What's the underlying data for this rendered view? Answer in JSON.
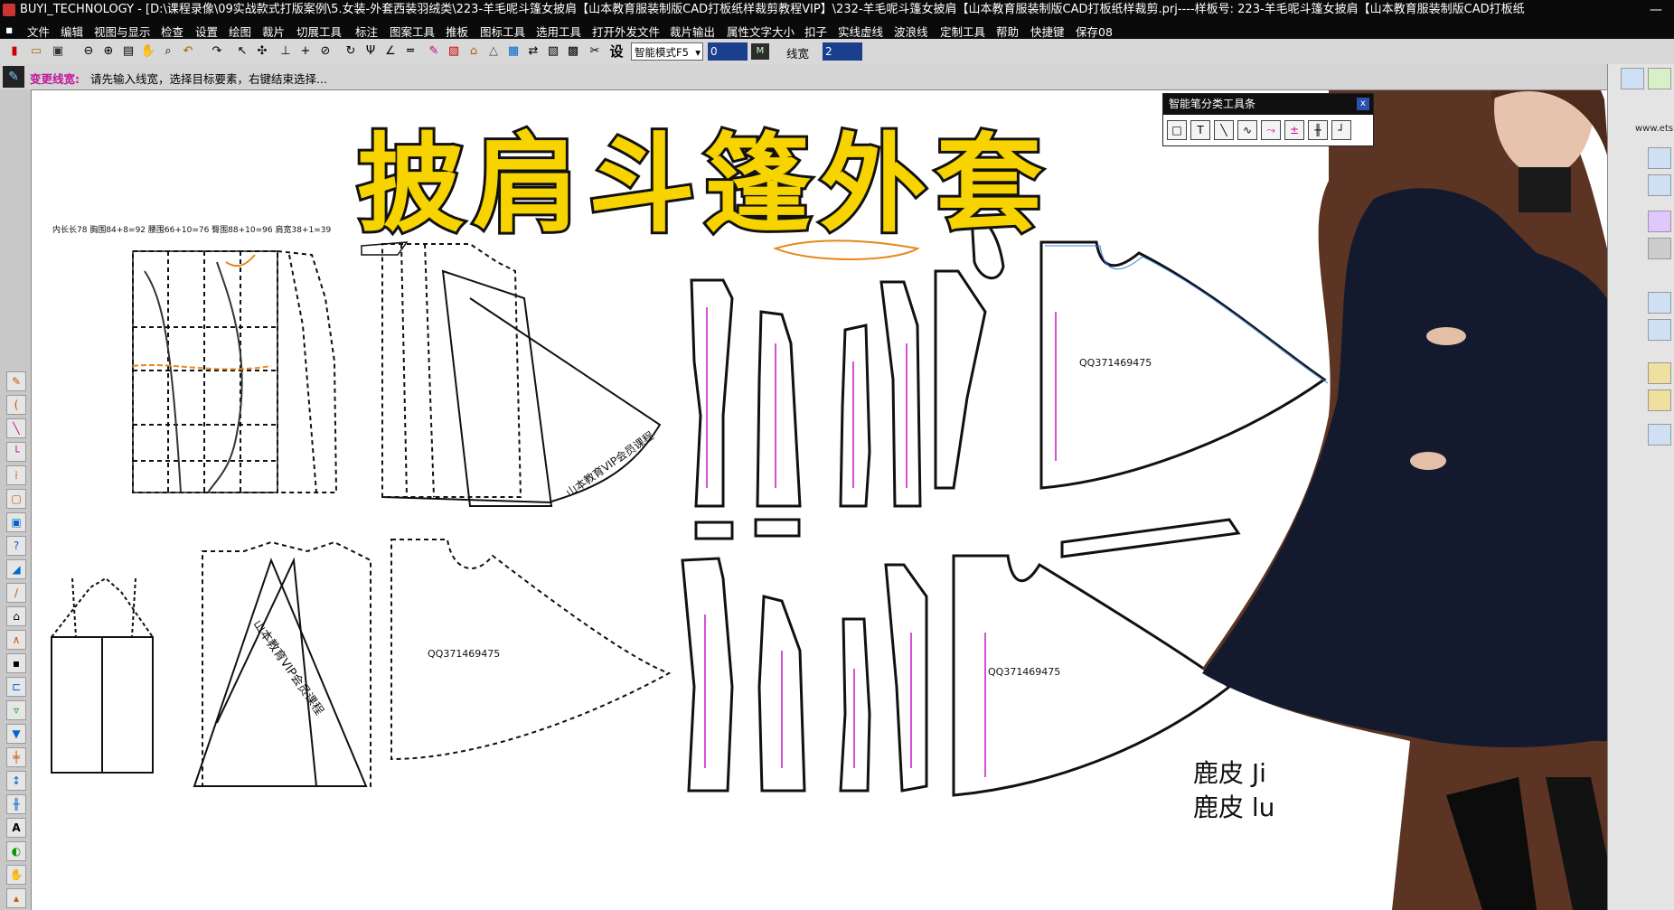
{
  "window": {
    "title": "BUYI_TECHNOLOGY - [D:\\课程录像\\09实战款式打版案例\\5.女装-外套西装羽绒类\\223-羊毛呢斗篷女披肩【山本教育服装制版CAD打板纸样裁剪教程VIP】\\232-羊毛呢斗篷女披肩【山本教育服装制版CAD打板纸样裁剪.prj----样板号: 223-羊毛呢斗篷女披肩【山本教育服装制版CAD打板纸",
    "minimize": "—"
  },
  "menu": [
    "文件",
    "编辑",
    "视图与显示",
    "检查",
    "设置",
    "绘图",
    "裁片",
    "切展工具",
    "标注",
    "图案工具",
    "推板",
    "图标工具",
    "选用工具",
    "打开外发文件",
    "裁片输出",
    "属性文字大小",
    "扣子",
    "实线虚线",
    "波浪线",
    "定制工具",
    "帮助",
    "快捷键",
    "保存08"
  ],
  "toolbar": {
    "mode_select": "智能模式F5",
    "value_input": "0",
    "line_width_label": "线宽",
    "line_width_value": "2",
    "set_label": "设"
  },
  "status": {
    "command": "变更线宽:",
    "prompt": "请先输入线宽，选择目标要素，右键结束选择..."
  },
  "canvas": {
    "headline": "披肩斗篷外套",
    "measurements": "内长长78   胸围84+8=92   腰围66+10=76   臀围88+10=96   肩宽38+1=39",
    "piece_code_1": "QQ371469475",
    "piece_code_2": "QQ371469475",
    "piece_code_3": "QQ371469475",
    "watermark_1": "山本教育VIP会员课程",
    "watermark_2": "山本教育VIP会员课程",
    "material_line_1": "鹿皮  Ji",
    "material_line_2": "鹿皮  lu"
  },
  "smart_toolbar": {
    "title": "智能笔分类工具条",
    "close": "x"
  },
  "right_panel": {
    "url_text": "www.ets"
  },
  "colors": {
    "headline_fill": "#f7d300",
    "title_bg": "#0a0a0a",
    "toolbar_bg": "#d8d8d8",
    "accent_blue": "#2d4fae",
    "coat": "#141a2e",
    "status_command": "#c0179a"
  }
}
